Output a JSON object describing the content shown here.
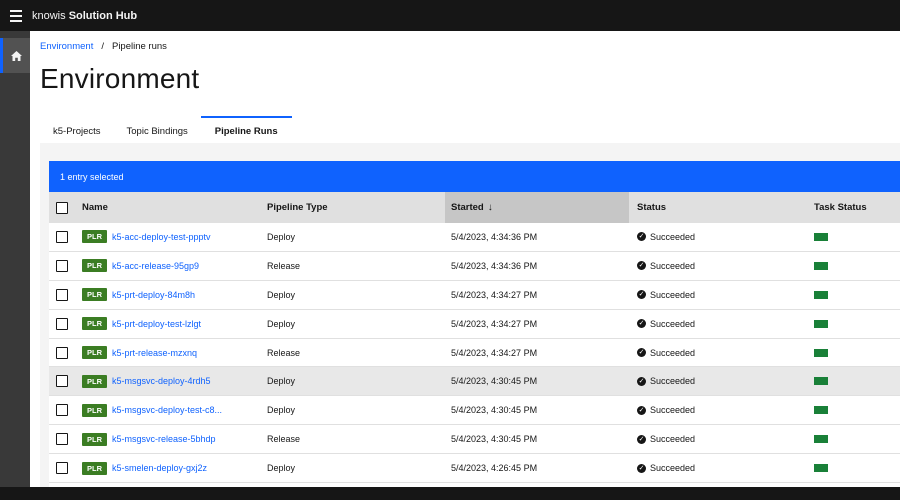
{
  "header": {
    "brand_prefix": "knowis",
    "brand_name": "Solution Hub"
  },
  "breadcrumb": {
    "link": "Environment",
    "separator": "/",
    "current": "Pipeline runs"
  },
  "page": {
    "title": "Environment"
  },
  "tabs": [
    {
      "label": "k5-Projects",
      "active": false
    },
    {
      "label": "Topic Bindings",
      "active": false
    },
    {
      "label": "Pipeline Runs",
      "active": true
    }
  ],
  "table": {
    "batch_text": "1 entry selected",
    "columns": {
      "name": "Name",
      "type": "Pipeline Type",
      "started": "Started",
      "status": "Status",
      "task": "Task Status"
    },
    "sort_arrow": "↓",
    "rows": [
      {
        "tag": "PLR",
        "name": "k5-acc-deploy-test-ppptv",
        "type": "Deploy",
        "started": "5/4/2023, 4:34:36 PM",
        "status": "Succeeded"
      },
      {
        "tag": "PLR",
        "name": "k5-acc-release-95gp9",
        "type": "Release",
        "started": "5/4/2023, 4:34:36 PM",
        "status": "Succeeded"
      },
      {
        "tag": "PLR",
        "name": "k5-prt-deploy-84m8h",
        "type": "Deploy",
        "started": "5/4/2023, 4:34:27 PM",
        "status": "Succeeded"
      },
      {
        "tag": "PLR",
        "name": "k5-prt-deploy-test-lzlgt",
        "type": "Deploy",
        "started": "5/4/2023, 4:34:27 PM",
        "status": "Succeeded"
      },
      {
        "tag": "PLR",
        "name": "k5-prt-release-mzxnq",
        "type": "Release",
        "started": "5/4/2023, 4:34:27 PM",
        "status": "Succeeded"
      },
      {
        "tag": "PLR",
        "name": "k5-msgsvc-deploy-4rdh5",
        "type": "Deploy",
        "started": "5/4/2023, 4:30:45 PM",
        "status": "Succeeded"
      },
      {
        "tag": "PLR",
        "name": "k5-msgsvc-deploy-test-c8...",
        "type": "Deploy",
        "started": "5/4/2023, 4:30:45 PM",
        "status": "Succeeded"
      },
      {
        "tag": "PLR",
        "name": "k5-msgsvc-release-5bhdp",
        "type": "Release",
        "started": "5/4/2023, 4:30:45 PM",
        "status": "Succeeded"
      },
      {
        "tag": "PLR",
        "name": "k5-smelen-deploy-gxj2z",
        "type": "Deploy",
        "started": "5/4/2023, 4:26:45 PM",
        "status": "Succeeded"
      }
    ]
  },
  "colors": {
    "accent": "#0f62fe",
    "tag_green": "#3b7d23",
    "task_green": "#198038",
    "header_bg": "#161616"
  },
  "icons": {
    "menu": "hamburger-menu-icon",
    "home": "home-icon",
    "status": "checkmark-filled-icon"
  }
}
